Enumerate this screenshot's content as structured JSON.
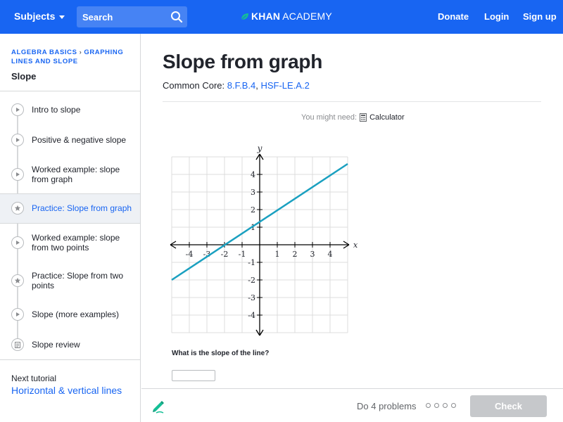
{
  "header": {
    "subjects_label": "Subjects",
    "search_placeholder": "Search",
    "logo_bold": "KHAN",
    "logo_light": "ACADEMY",
    "donate_label": "Donate",
    "login_label": "Login",
    "signup_label": "Sign up"
  },
  "sidebar": {
    "breadcrumb_1": "ALGEBRA BASICS",
    "breadcrumb_2": "GRAPHING LINES AND SLOPE",
    "title": "Slope",
    "items": [
      {
        "label": "Intro to slope",
        "type": "video"
      },
      {
        "label": "Positive & negative slope",
        "type": "video"
      },
      {
        "label": "Worked example: slope from graph",
        "type": "video"
      },
      {
        "label": "Practice: Slope from graph",
        "type": "exercise",
        "active": true
      },
      {
        "label": "Worked example: slope from two points",
        "type": "video"
      },
      {
        "label": "Practice: Slope from two points",
        "type": "exercise"
      },
      {
        "label": "Slope (more examples)",
        "type": "video"
      },
      {
        "label": "Slope review",
        "type": "article"
      }
    ],
    "next_label": "Next tutorial",
    "next_link": "Horizontal & vertical lines"
  },
  "main": {
    "title": "Slope from graph",
    "common_core_label": "Common Core:",
    "standard_1": "8.F.B.4",
    "standard_2": "HSF-LE.A.2",
    "you_might_need": "You might need:",
    "calculator_label": "Calculator",
    "question": "What is the slope of the line?",
    "answer_value": ""
  },
  "graph": {
    "x_label": "x",
    "y_label": "y",
    "x_ticks": [
      "-4",
      "-3",
      "-2",
      "-1",
      "1",
      "2",
      "3",
      "4"
    ],
    "y_ticks": [
      "4",
      "3",
      "2",
      "1",
      "-1",
      "-2",
      "-3",
      "-4"
    ],
    "line": {
      "x1": -5,
      "y1": -2,
      "x2": 5,
      "y2": 4.6
    },
    "line_color": "#1aa0c0"
  },
  "footer": {
    "do_problems": "Do 4 problems",
    "check_label": "Check"
  },
  "colors": {
    "brand": "#1865f2",
    "disabled_button": "#c6c8cb"
  }
}
